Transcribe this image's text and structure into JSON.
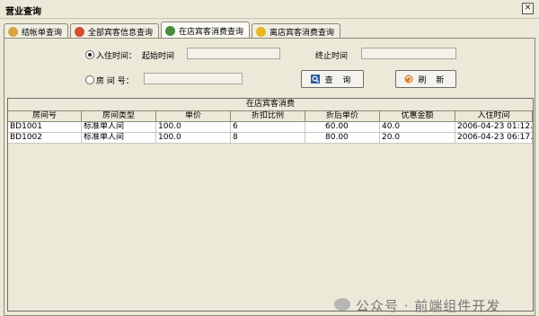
{
  "window": {
    "title": "营业查询",
    "close_glyph": "✕"
  },
  "tabs": [
    {
      "label": "结帐单查询",
      "icon": "receipt-icon",
      "color": "#d9a441"
    },
    {
      "label": "全部宾客信息查询",
      "icon": "guest-icon",
      "color": "#d64a2e"
    },
    {
      "label": "在店宾客消费查询",
      "icon": "search-person-icon",
      "color": "#4a8a3c",
      "active": true
    },
    {
      "label": "离店宾客消费查询",
      "icon": "star-icon",
      "color": "#e8b820"
    }
  ],
  "filters": {
    "checkin_radio_label": "入住时间：",
    "start_label": "起始时间",
    "end_label": "终止时间",
    "room_radio_label": "房 间 号：",
    "start_value": "",
    "end_value": "",
    "room_value": ""
  },
  "buttons": {
    "query": "查 询",
    "refresh": "刷 新"
  },
  "grid": {
    "title": "在店宾客消费",
    "columns": [
      "房间号",
      "房间类型",
      "单价",
      "折扣比例",
      "折后单价",
      "优惠金额",
      "入住时间"
    ],
    "rows": [
      [
        "BD1001",
        "标准单人间",
        "100.0",
        "6",
        "60.00",
        "40.0",
        "2006-04-23 01:12..."
      ],
      [
        "BD1002",
        "标准单人间",
        "100.0",
        "8",
        "80.00",
        "20.0",
        "2006-04-23 06:17..."
      ]
    ]
  },
  "watermark": "公众号 · 前端组件开发"
}
